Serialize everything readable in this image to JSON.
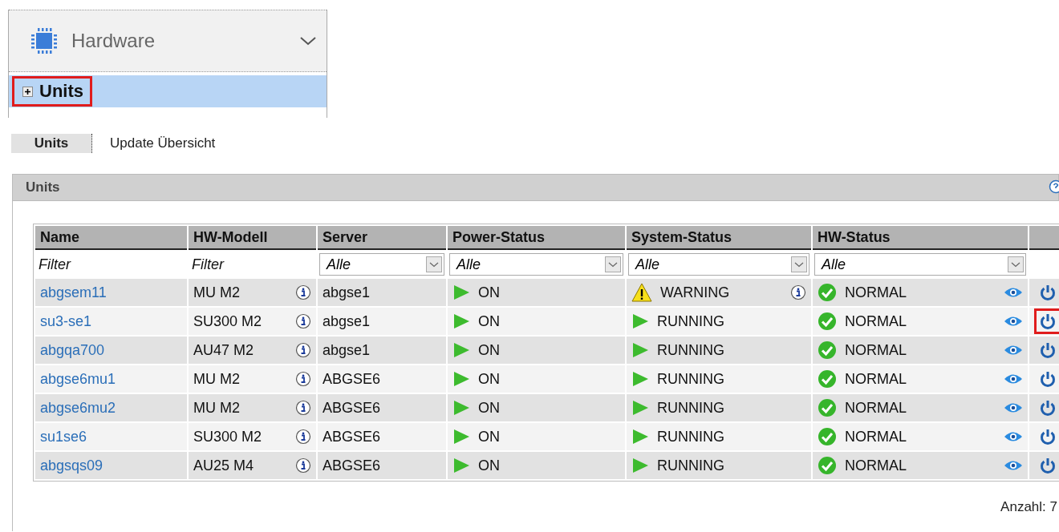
{
  "tree": {
    "title": "Hardware",
    "expanded": true,
    "items": [
      {
        "label": "Units",
        "expanded": false,
        "selected": true,
        "highlighted": true
      }
    ]
  },
  "tabs": [
    {
      "label": "Units",
      "selected": true
    },
    {
      "label": "Update Übersicht",
      "selected": false
    }
  ],
  "panel": {
    "title": "Units",
    "table": {
      "columns": [
        "Name",
        "HW-Modell",
        "Server",
        "Power-Status",
        "System-Status",
        "HW-Status"
      ],
      "filters": [
        {
          "kind": "text",
          "placeholder": "Filter"
        },
        {
          "kind": "text",
          "placeholder": "Filter"
        },
        {
          "kind": "select",
          "value": "Alle"
        },
        {
          "kind": "select",
          "value": "Alle"
        },
        {
          "kind": "select",
          "value": "Alle"
        },
        {
          "kind": "select",
          "value": "Alle"
        }
      ],
      "rows": [
        {
          "name": "abgsem11",
          "model": "MU M2",
          "server": "abgse1",
          "power": {
            "kind": "on",
            "text": "ON"
          },
          "system": {
            "kind": "warning",
            "text": "WARNING",
            "info": true
          },
          "hw": {
            "kind": "normal",
            "text": "NORMAL"
          },
          "power_highlighted": false
        },
        {
          "name": "su3-se1",
          "model": "SU300 M2",
          "server": "abgse1",
          "power": {
            "kind": "on",
            "text": "ON"
          },
          "system": {
            "kind": "running",
            "text": "RUNNING",
            "info": false
          },
          "hw": {
            "kind": "normal",
            "text": "NORMAL"
          },
          "power_highlighted": true
        },
        {
          "name": "abgqa700",
          "model": "AU47 M2",
          "server": "abgse1",
          "power": {
            "kind": "on",
            "text": "ON"
          },
          "system": {
            "kind": "running",
            "text": "RUNNING",
            "info": false
          },
          "hw": {
            "kind": "normal",
            "text": "NORMAL"
          },
          "power_highlighted": false
        },
        {
          "name": "abgse6mu1",
          "model": "MU M2",
          "server": "ABGSE6",
          "power": {
            "kind": "on",
            "text": "ON"
          },
          "system": {
            "kind": "running",
            "text": "RUNNING",
            "info": false
          },
          "hw": {
            "kind": "normal",
            "text": "NORMAL"
          },
          "power_highlighted": false
        },
        {
          "name": "abgse6mu2",
          "model": "MU M2",
          "server": "ABGSE6",
          "power": {
            "kind": "on",
            "text": "ON"
          },
          "system": {
            "kind": "running",
            "text": "RUNNING",
            "info": false
          },
          "hw": {
            "kind": "normal",
            "text": "NORMAL"
          },
          "power_highlighted": false
        },
        {
          "name": "su1se6",
          "model": "SU300 M2",
          "server": "ABGSE6",
          "power": {
            "kind": "on",
            "text": "ON"
          },
          "system": {
            "kind": "running",
            "text": "RUNNING",
            "info": false
          },
          "hw": {
            "kind": "normal",
            "text": "NORMAL"
          },
          "power_highlighted": false
        },
        {
          "name": "abgsqs09",
          "model": "AU25 M4",
          "server": "ABGSE6",
          "power": {
            "kind": "on",
            "text": "ON"
          },
          "system": {
            "kind": "running",
            "text": "RUNNING",
            "info": false
          },
          "hw": {
            "kind": "normal",
            "text": "NORMAL"
          },
          "power_highlighted": false
        }
      ]
    },
    "count": "Anzahl: 7"
  }
}
